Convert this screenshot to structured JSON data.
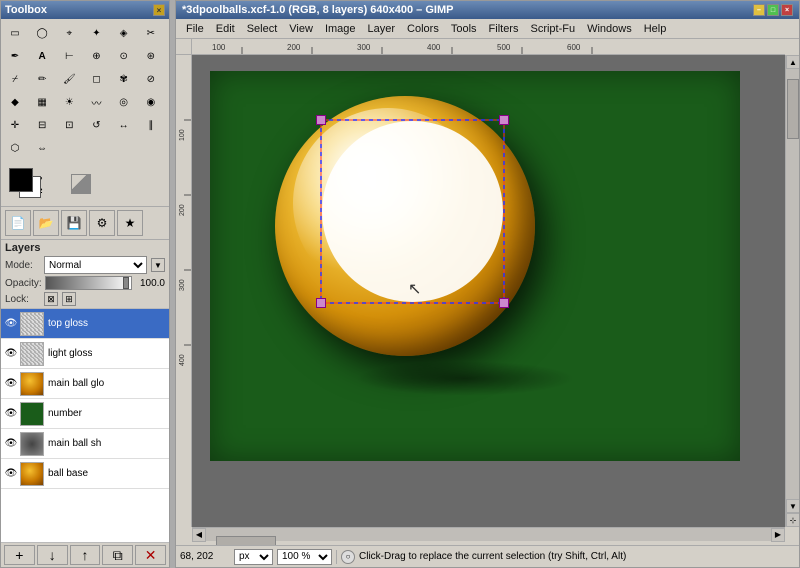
{
  "toolbox": {
    "title": "Toolbox",
    "tools": [
      {
        "name": "rect-select",
        "icon": "▭",
        "active": false
      },
      {
        "name": "ellipse-select",
        "icon": "◯",
        "active": false
      },
      {
        "name": "free-select",
        "icon": "⌖",
        "active": false
      },
      {
        "name": "fuzzy-select",
        "icon": "✦",
        "active": false
      },
      {
        "name": "select-by-color",
        "icon": "◈",
        "active": false
      },
      {
        "name": "scissors-select",
        "icon": "✂",
        "active": false
      },
      {
        "name": "paths",
        "icon": "✒",
        "active": false
      },
      {
        "name": "text",
        "icon": "A",
        "active": false
      },
      {
        "name": "measure",
        "icon": "⊢",
        "active": false
      },
      {
        "name": "zoom",
        "icon": "⊕",
        "active": false
      },
      {
        "name": "clone",
        "icon": "⊙",
        "active": false
      },
      {
        "name": "heal",
        "icon": "⊛",
        "active": false
      },
      {
        "name": "perspective-clone",
        "icon": "⌿",
        "active": false
      },
      {
        "name": "pencil",
        "icon": "✏",
        "active": false
      },
      {
        "name": "paintbrush",
        "icon": "🖌",
        "active": false
      },
      {
        "name": "eraser",
        "icon": "◻",
        "active": false
      },
      {
        "name": "airbrush",
        "icon": "✾",
        "active": false
      },
      {
        "name": "ink",
        "icon": "⊘",
        "active": false
      },
      {
        "name": "bucket-fill",
        "icon": "◆",
        "active": false
      },
      {
        "name": "blend",
        "icon": "▦",
        "active": false
      },
      {
        "name": "dodge-burn",
        "icon": "☀",
        "active": false
      },
      {
        "name": "smudge",
        "icon": "~",
        "active": false
      },
      {
        "name": "convolve",
        "icon": "◎",
        "active": false
      },
      {
        "name": "colorize",
        "icon": "◉",
        "active": false
      },
      {
        "name": "move",
        "icon": "✛",
        "active": false
      },
      {
        "name": "align",
        "icon": "⊟",
        "active": false
      },
      {
        "name": "crop",
        "icon": "⊡",
        "active": false
      },
      {
        "name": "rotate",
        "icon": "↺",
        "active": false
      },
      {
        "name": "scale",
        "icon": "↔",
        "active": false
      },
      {
        "name": "shear",
        "icon": "∥",
        "active": false
      },
      {
        "name": "perspective",
        "icon": "⬡",
        "active": false
      },
      {
        "name": "flip",
        "icon": "⇔",
        "active": false
      }
    ],
    "layers": {
      "title": "Layers",
      "mode_label": "Mode:",
      "mode_value": "Normal",
      "opacity_label": "Opacity:",
      "opacity_value": "100.0",
      "lock_label": "Lock:",
      "items": [
        {
          "name": "top gloss",
          "visible": true,
          "selected": true,
          "type": "gloss"
        },
        {
          "name": "light gloss",
          "visible": true,
          "selected": false,
          "type": "light"
        },
        {
          "name": "main ball glo",
          "visible": true,
          "selected": false,
          "type": "main"
        },
        {
          "name": "number",
          "visible": true,
          "selected": false,
          "type": "number"
        },
        {
          "name": "main ball sh",
          "visible": true,
          "selected": false,
          "type": "shadow"
        },
        {
          "name": "ball base",
          "visible": true,
          "selected": false,
          "type": "base"
        }
      ],
      "footer_buttons": [
        "+",
        "↓",
        "↑",
        "✕"
      ]
    }
  },
  "main_window": {
    "title": "*3dpoolballs.xcf-1.0 (RGB, 8 layers) 640x400 – GIMP",
    "menu": [
      "File",
      "Edit",
      "Select",
      "View",
      "Image",
      "Layer",
      "Colors",
      "Tools",
      "Filters",
      "Script-Fu",
      "Windows",
      "Help"
    ],
    "ruler": {
      "h_marks": [
        "100",
        "200",
        "300",
        "400",
        "500",
        "600"
      ],
      "v_marks": [
        "100",
        "200",
        "300"
      ]
    },
    "statusbar": {
      "coords": "68, 202",
      "unit": "px",
      "zoom": "100 %",
      "message": "Click-Drag to replace the current selection (try Shift, Ctrl, Alt)"
    }
  }
}
